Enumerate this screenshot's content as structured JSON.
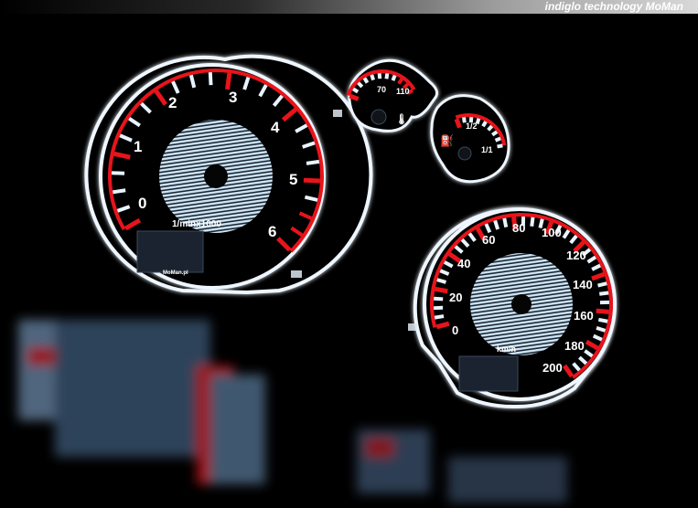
{
  "header": {
    "tagline": "indiglo technology",
    "brand": "MoMan"
  },
  "tachometer": {
    "labels": [
      "0",
      "1",
      "2",
      "3",
      "4",
      "5",
      "6"
    ],
    "unit": "1/minx1000",
    "maker": "MoMan.pl"
  },
  "speedometer": {
    "labels": [
      "0",
      "20",
      "40",
      "60",
      "80",
      "100",
      "120",
      "140",
      "160",
      "180",
      "200"
    ],
    "unit": "km/h"
  },
  "temp_gauge": {
    "labels": [
      "70",
      "110"
    ]
  },
  "fuel_gauge": {
    "labels": [
      "1/2",
      "1/1"
    ]
  },
  "colors": {
    "glow": "#e8f4ff",
    "accent": "#e8141b",
    "face": "#050505"
  }
}
